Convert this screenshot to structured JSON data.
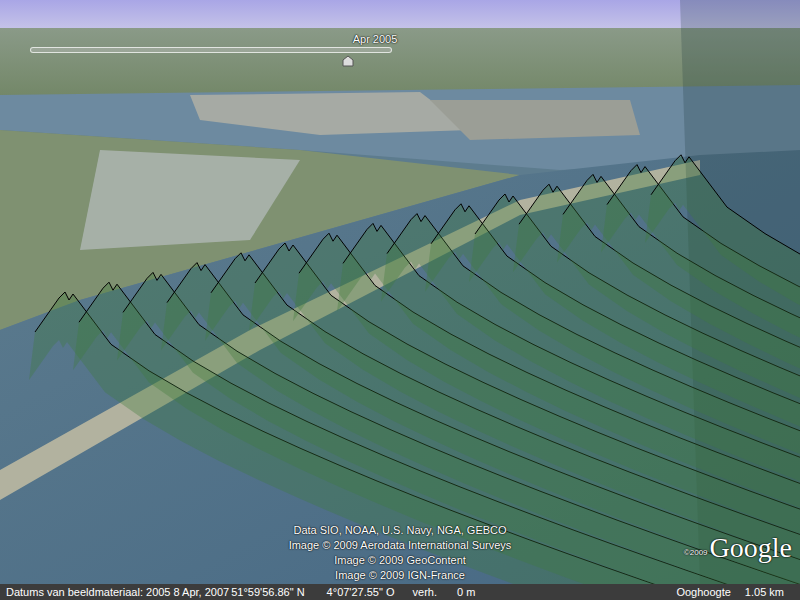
{
  "timeline": {
    "label": "Apr 2005"
  },
  "attribution": [
    "Data SIO, NOAA, U.S. Navy, NGA, GEBCO",
    "Image © 2009 Aerodata International Surveys",
    "Image © 2009 GeoContent",
    "Image © 2009 IGN-France"
  ],
  "logo": {
    "copyright": "©2009",
    "text": "Google"
  },
  "status_bar": {
    "imagery_date": "Datums van beeldmateriaal: 2005 8 Apr, 2007",
    "latitude": "51°59'56.86\" N",
    "longitude": "4°07'27.55\" O",
    "elevation_label": "verh.",
    "elevation": "0 m",
    "eye_alt_label": "Ooghoogte",
    "eye_alt": "1.05 km"
  }
}
